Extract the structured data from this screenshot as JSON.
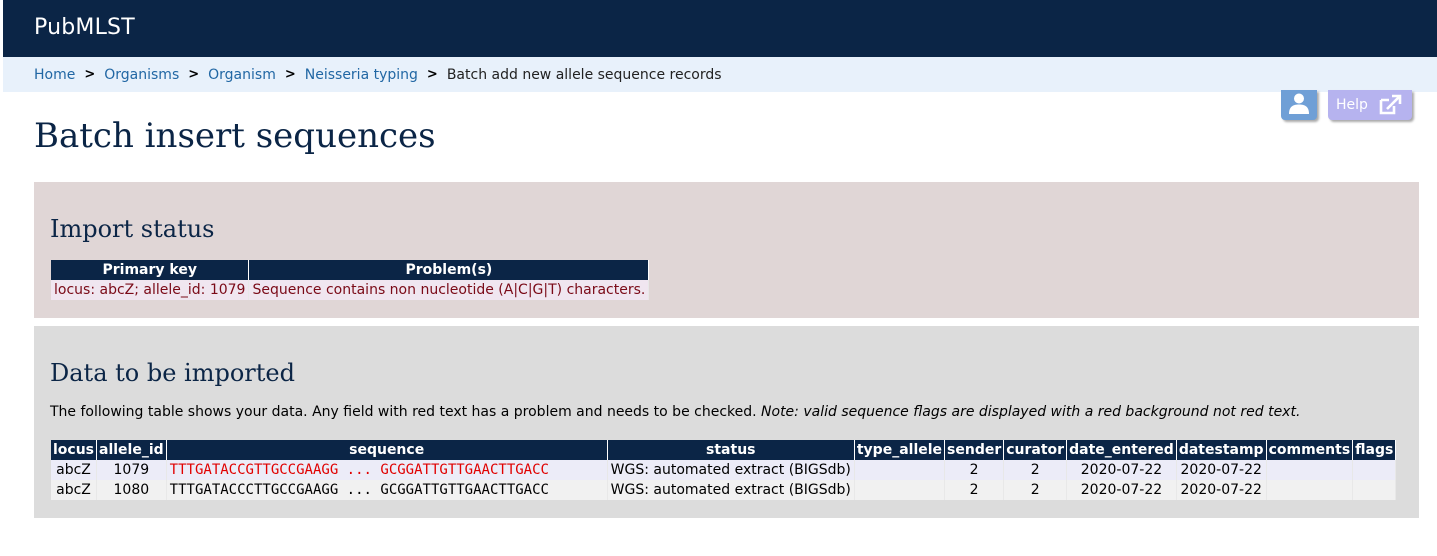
{
  "app": {
    "brand": "PubMLST"
  },
  "breadcrumb": {
    "items": [
      "Home",
      "Organisms",
      "Organism",
      "Neisseria typing"
    ],
    "current": "Batch add new allele sequence records",
    "separator": ">"
  },
  "toolbar": {
    "help_label": "Help"
  },
  "page": {
    "title": "Batch insert sequences"
  },
  "import_status": {
    "heading": "Import status",
    "columns": [
      "Primary key",
      "Problem(s)"
    ],
    "rows": [
      {
        "primary_key": "locus: abcZ; allele_id: 1079",
        "problem": "Sequence contains non nucleotide (A|C|G|T) characters."
      }
    ]
  },
  "data_import": {
    "heading": "Data to be imported",
    "intro": "The following table shows your data. Any field with red text has a problem and needs to be checked.",
    "note": "Note: valid sequence flags are displayed with a red background not red text.",
    "columns": [
      "locus",
      "allele_id",
      "sequence",
      "status",
      "type_allele",
      "sender",
      "curator",
      "date_entered",
      "datestamp",
      "comments",
      "flags"
    ],
    "rows": [
      {
        "locus": "abcZ",
        "allele_id": "1079",
        "sequence": "TTTGATACCGTTGCCGAAGG ... GCGGATTGTTGAACTTGACC",
        "status": "WGS: automated extract (BIGSdb)",
        "type_allele": "",
        "sender": "2",
        "curator": "2",
        "date_entered": "2020-07-22",
        "datestamp": "2020-07-22",
        "comments": "",
        "flags": ""
      },
      {
        "locus": "abcZ",
        "allele_id": "1080",
        "sequence": "TTTGATACCCTTGCCGAAGG ... GCGGATTGTTGAACTTGACC",
        "status": "WGS: automated extract (BIGSdb)",
        "type_allele": "",
        "sender": "2",
        "curator": "2",
        "date_entered": "2020-07-22",
        "datestamp": "2020-07-22",
        "comments": "",
        "flags": ""
      }
    ]
  },
  "colors": {
    "header_bg": "#0b2546",
    "breadcrumb_bg": "#e8f1fb",
    "link": "#2167a4",
    "error_text": "#e00000",
    "status_box_bg": "#e0d6d6",
    "data_box_bg": "#dcdcdc"
  }
}
